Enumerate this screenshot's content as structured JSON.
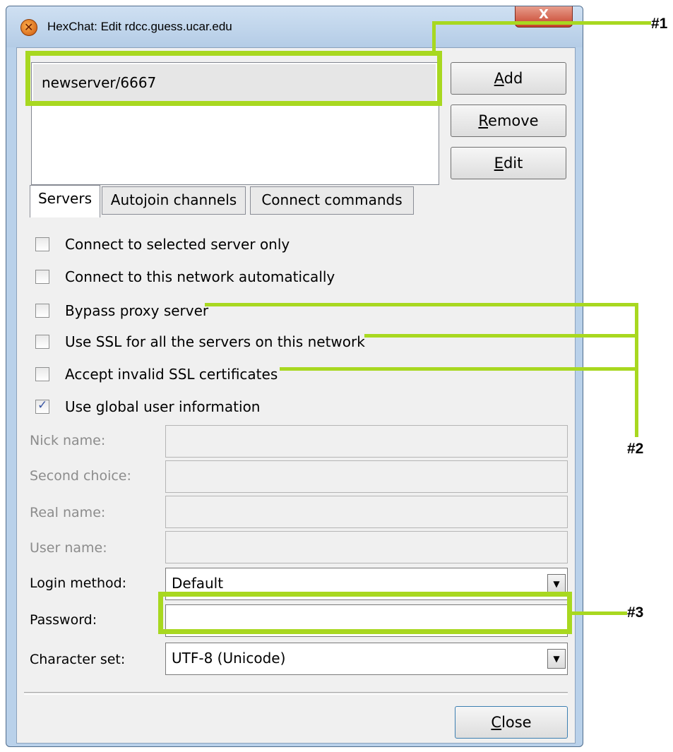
{
  "window": {
    "title": "HexChat: Edit rdcc.guess.ucar.edu",
    "close_glyph": "X"
  },
  "server_list": {
    "items": [
      "newserver/6667"
    ]
  },
  "buttons": {
    "add": {
      "prefix": "",
      "mnemonic": "A",
      "rest": "dd"
    },
    "remove": {
      "prefix": "",
      "mnemonic": "R",
      "rest": "emove"
    },
    "edit": {
      "prefix": "",
      "mnemonic": "E",
      "rest": "dit"
    },
    "close": {
      "prefix": "",
      "mnemonic": "C",
      "rest": "lose"
    }
  },
  "tabs": [
    "Servers",
    "Autojoin channels",
    "Connect commands"
  ],
  "options": [
    {
      "label": "Connect to selected server only",
      "checked": false
    },
    {
      "label": "Connect to this network automatically",
      "checked": false
    },
    {
      "label": "Bypass proxy server",
      "checked": false
    },
    {
      "label": "Use SSL for all the servers on this network",
      "checked": false
    },
    {
      "label": "Accept invalid SSL certificates",
      "checked": false
    },
    {
      "label": "Use global user information",
      "checked": true
    }
  ],
  "fields": {
    "nick_name": {
      "label": "Nick name:",
      "value": ""
    },
    "second_choice": {
      "label": "Second choice:",
      "value": ""
    },
    "real_name": {
      "label": "Real name:",
      "value": ""
    },
    "user_name": {
      "label": "User name:",
      "value": ""
    },
    "login_method": {
      "label": "Login method:",
      "value": "Default"
    },
    "password": {
      "label": "Password:",
      "value": ""
    },
    "character_set": {
      "label": "Character set:",
      "value": "UTF-8 (Unicode)"
    }
  },
  "annotations": {
    "marker1": "#1",
    "marker2": "#2",
    "marker3": "#3",
    "color": "#a8d820"
  }
}
